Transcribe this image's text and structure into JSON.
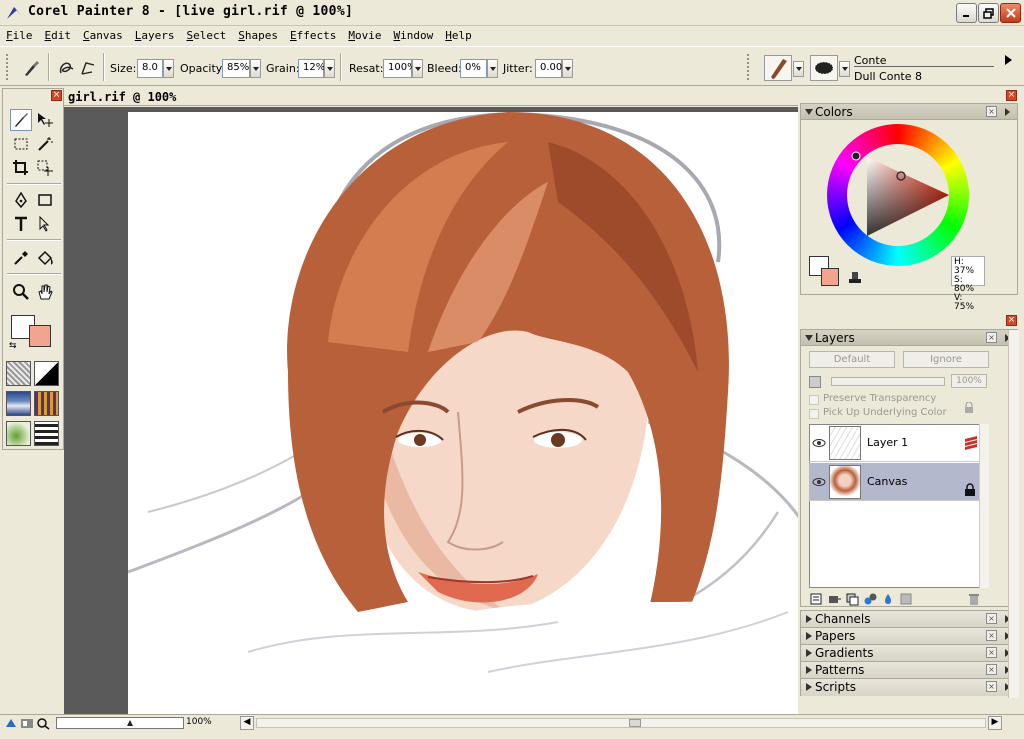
{
  "window": {
    "title": "Corel Painter 8 - [live girl.rif @ 100%]"
  },
  "menu": [
    {
      "label": "File"
    },
    {
      "label": "Edit"
    },
    {
      "label": "Canvas"
    },
    {
      "label": "Layers"
    },
    {
      "label": "Select"
    },
    {
      "label": "Shapes"
    },
    {
      "label": "Effects"
    },
    {
      "label": "Movie"
    },
    {
      "label": "Window"
    },
    {
      "label": "Help"
    }
  ],
  "property_bar": {
    "size_label": "Size:",
    "size_value": "8.0",
    "opacity_label": "Opacity:",
    "opacity_value": "85%",
    "grain_label": "Grain:",
    "grain_value": "12%",
    "resat_label": "Resat:",
    "resat_value": "100%",
    "bleed_label": "Bleed:",
    "bleed_value": "0%",
    "jitter_label": "Jitter:",
    "jitter_value": "0.00",
    "brush_category": "Conte",
    "brush_variant": "Dull Conte 8"
  },
  "document": {
    "title": "girl.rif @ 100%"
  },
  "status": {
    "zoom": "100%"
  },
  "colors_panel": {
    "title": "Colors",
    "h": "H: 37%",
    "s": "S: 80%",
    "v": "V: 75%",
    "main_color": "#ffffff",
    "additional_color": "#f2a48e"
  },
  "layers_panel": {
    "title": "Layers",
    "composite_method": "Default",
    "depth": "Ignore",
    "opacity": "100%",
    "preserve_transparency": "Preserve Transparency",
    "pick_up_underlying": "Pick Up Underlying Color",
    "layers": [
      {
        "name": "Layer 1"
      },
      {
        "name": "Canvas"
      }
    ]
  },
  "collapsed_panels": [
    {
      "title": "Channels"
    },
    {
      "title": "Papers"
    },
    {
      "title": "Gradients"
    },
    {
      "title": "Patterns"
    },
    {
      "title": "Scripts"
    }
  ]
}
